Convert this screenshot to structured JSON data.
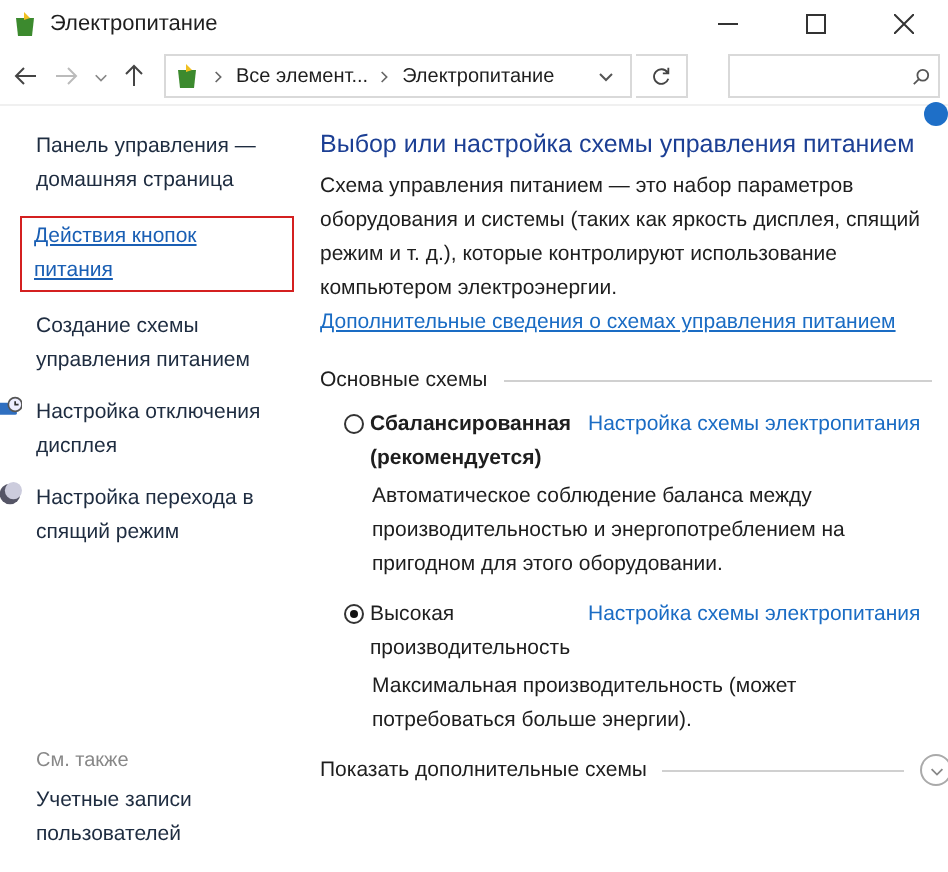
{
  "window": {
    "title": "Электропитание"
  },
  "address": {
    "crumbs": [
      "Все элемент...",
      "Электропитание"
    ]
  },
  "sidebar": {
    "items": [
      {
        "label": "Панель управления — домашняя страница",
        "outlined": false
      },
      {
        "label": "Действия кнопок питания",
        "outlined": true
      },
      {
        "label": "Создание схемы управления питанием",
        "outlined": false
      },
      {
        "label": "Настройка отключения дисплея",
        "outlined": false
      },
      {
        "label": "Настройка перехода в спящий режим",
        "outlined": false
      }
    ],
    "see_also": {
      "heading": "См. также",
      "items": [
        "Учетные записи пользователей"
      ]
    }
  },
  "main": {
    "title": "Выбор или настройка схемы управления питанием",
    "intro": "Схема управления питанием — это набор параметров оборудования и системы (таких как яркость дисплея, спящий режим и т. д.), которые контролируют использование компьютером электроэнергии.",
    "intro_link": "Дополнительные сведения о схемах управления питанием",
    "section": "Основные схемы",
    "schemes": [
      {
        "name": "Сбалансированная (рекомендуется)",
        "recommended": true,
        "selected": false,
        "link": "Настройка схемы электропитания",
        "description": "Автоматическое соблюдение баланса между производительностью и энергопотреблением на пригодном для этого оборудовании."
      },
      {
        "name": "Высокая производительность",
        "recommended": false,
        "selected": true,
        "link": "Настройка схемы электропитания",
        "description": "Максимальная производительность (может потребоваться больше энергии)."
      }
    ],
    "more": "Показать дополнительные схемы"
  }
}
